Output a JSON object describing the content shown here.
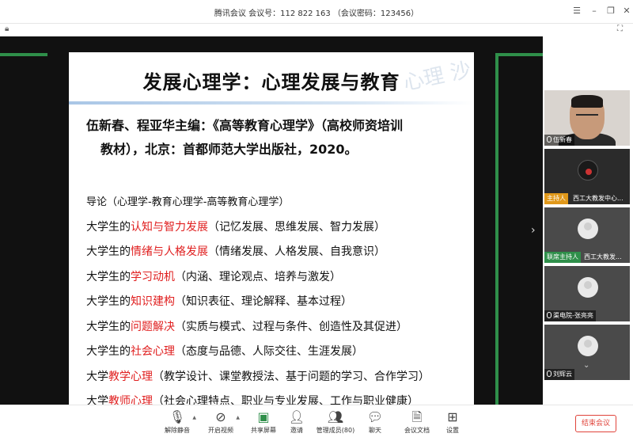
{
  "window": {
    "title": "腾讯会议  会议号：112 822 163  （会议密码：123456）"
  },
  "slide": {
    "title": "发展心理学：心理发展与教育",
    "watermark": "心理 沙",
    "reference_line1": "伍新春、程亚华主编：《高等教育心理学》（高校师资培训",
    "reference_line2": "教材），北京：首都师范大学出版社，2020。",
    "outline": [
      {
        "prefix": "导论（心理学-教育心理学-高等教育心理学）",
        "highlight": "",
        "suffix": ""
      },
      {
        "prefix": "大学生的",
        "highlight": "认知与智力发展",
        "suffix": "（记忆发展、思维发展、智力发展）"
      },
      {
        "prefix": "大学生的",
        "highlight": "情绪与人格发展",
        "suffix": "（情绪发展、人格发展、自我意识）"
      },
      {
        "prefix": "大学生的",
        "highlight": "学习动机",
        "suffix": "（内涵、理论观点、培养与激发）"
      },
      {
        "prefix": "大学生的",
        "highlight": "知识建构",
        "suffix": "（知识表征、理论解释、基本过程）"
      },
      {
        "prefix": "大学生的",
        "highlight": "问题解决",
        "suffix": "（实质与模式、过程与条件、创造性及其促进）"
      },
      {
        "prefix": "大学生的",
        "highlight": "社会心理",
        "suffix": "（态度与品德、人际交往、生涯发展）"
      },
      {
        "prefix": "大学",
        "highlight": "教学心理",
        "suffix": "（教学设计、课堂教授法、基于问题的学习、合作学习）"
      },
      {
        "prefix": "大学",
        "highlight": "教师心理",
        "suffix": "（社会心理特点、职业与专业发展、工作与职业健康）"
      }
    ]
  },
  "participants": [
    {
      "name": "伍新春",
      "role": ""
    },
    {
      "name": "西工大教发中心...",
      "role": "主持人"
    },
    {
      "name": "西工大教发...",
      "role": "联席主持人"
    },
    {
      "name": "渠电院-张亮亮",
      "role": ""
    },
    {
      "name": "刘辉云",
      "role": ""
    }
  ],
  "toolbar": {
    "unmute": "解除静音",
    "video": "开启视频",
    "share": "共享屏幕",
    "invite": "邀请",
    "members": "管理成员(80)",
    "chat": "聊天",
    "docs": "会议文档",
    "settings": "设置",
    "end": "结束会议"
  },
  "colors": {
    "highlight": "#e02020",
    "host_badge": "#e0981a",
    "cohost_badge": "#2f8f4a",
    "end_button": "#e0443b"
  }
}
